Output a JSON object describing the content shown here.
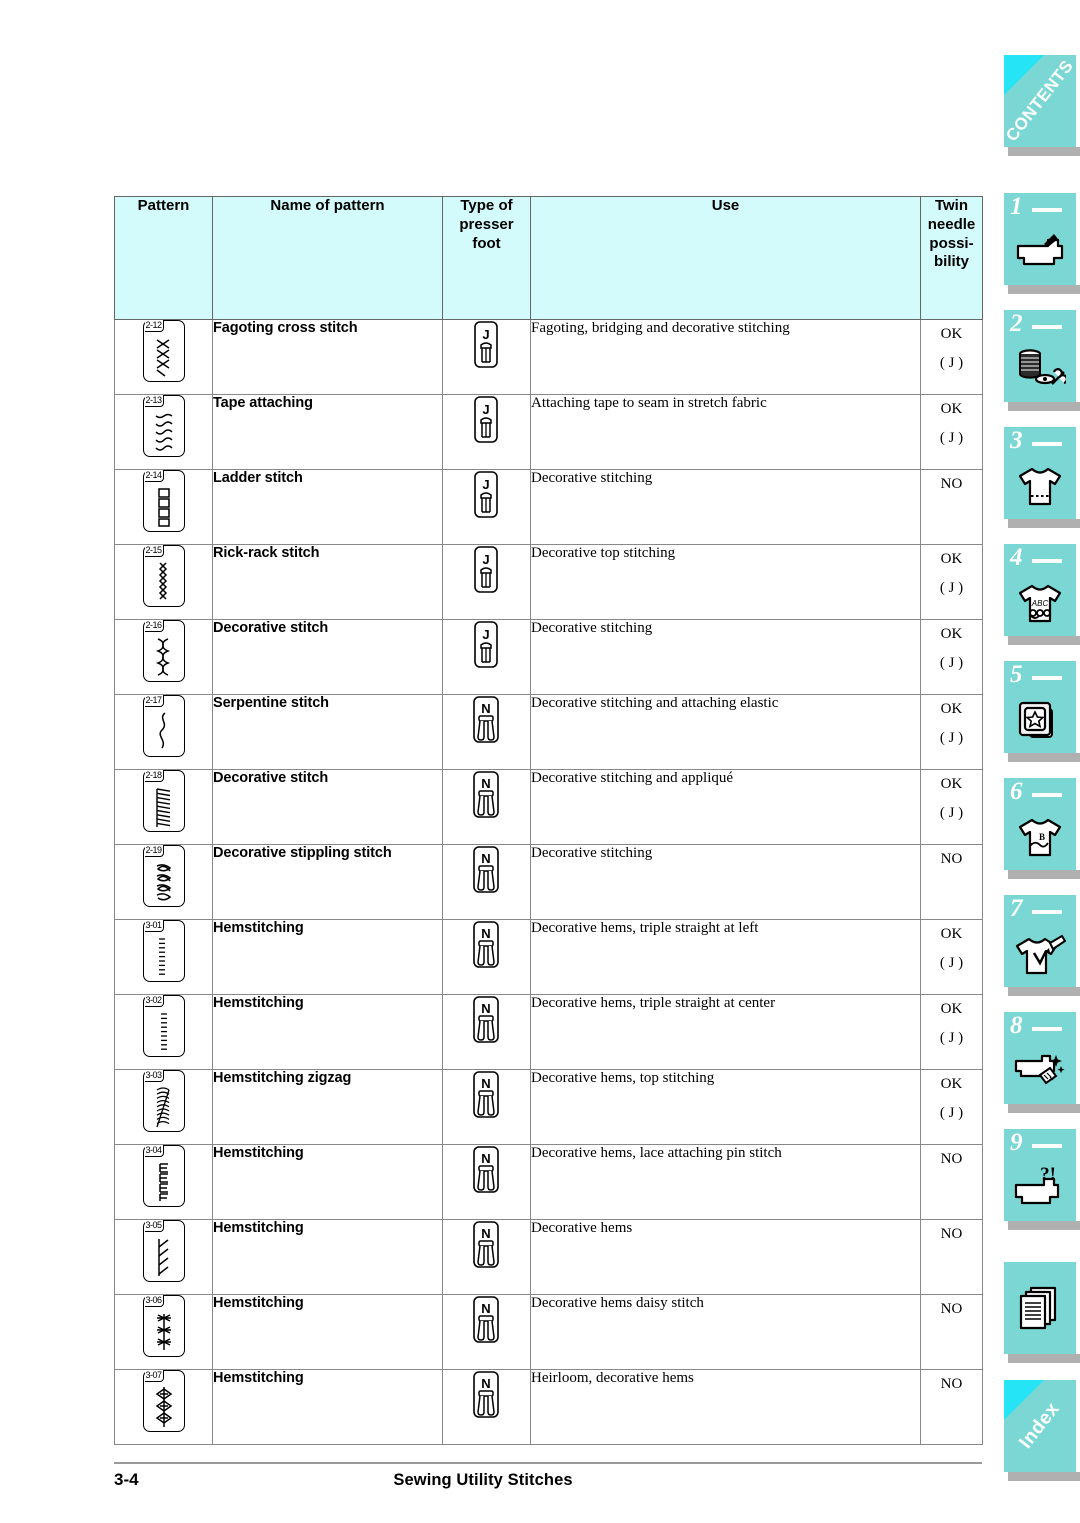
{
  "page": {
    "footer_page_number": "3-4",
    "footer_title": "Sewing Utility Stitches"
  },
  "colors": {
    "header_fill": "#d4fbfb",
    "tab_fill": "#7ad7d3",
    "tab_shadow": "#b0b0b0",
    "tab_corner": "#25e4f5",
    "border": "#888888"
  },
  "table": {
    "headers": {
      "pattern": "Pattern",
      "name": "Name of pattern",
      "presser_foot": "Type of presser foot",
      "use": "Use",
      "twin_needle": "Twin needle possi- bility"
    },
    "header_lines": {
      "presser_foot": [
        "Type of",
        "presser",
        "foot"
      ],
      "twin_needle": [
        "Twin",
        "needle",
        "possi-",
        "bility"
      ]
    },
    "rows": [
      {
        "code": "2-12",
        "name": "Fagoting cross stitch",
        "foot": "J",
        "use": "Fagoting, bridging and decorative stitching",
        "twin": "OK",
        "twin_sub": "( J )",
        "art": "cross"
      },
      {
        "code": "2-13",
        "name": "Tape attaching",
        "foot": "J",
        "use": "Attaching tape to seam in stretch fabric",
        "twin": "OK",
        "twin_sub": "( J )",
        "art": "wave-zig"
      },
      {
        "code": "2-14",
        "name": "Ladder stitch",
        "foot": "J",
        "use": "Decorative stitching",
        "twin": "NO",
        "twin_sub": "",
        "art": "ladder"
      },
      {
        "code": "2-15",
        "name": "Rick-rack stitch",
        "foot": "J",
        "use": "Decorative top stitching",
        "twin": "OK",
        "twin_sub": "( J )",
        "art": "rickrack"
      },
      {
        "code": "2-16",
        "name": "Decorative stitch",
        "foot": "J",
        "use": "Decorative stitching",
        "twin": "OK",
        "twin_sub": "( J )",
        "art": "braid"
      },
      {
        "code": "2-17",
        "name": "Serpentine stitch",
        "foot": "N",
        "use": "Decorative stitching and attaching elastic",
        "twin": "OK",
        "twin_sub": "( J )",
        "art": "serpentine"
      },
      {
        "code": "2-18",
        "name": "Decorative stitch",
        "foot": "N",
        "use": "Decorative stitching and appliqué",
        "twin": "OK",
        "twin_sub": "( J )",
        "art": "dense-zig"
      },
      {
        "code": "2-19",
        "name": "Decorative stippling stitch",
        "foot": "N",
        "use": "Decorative stitching",
        "twin": "NO",
        "twin_sub": "",
        "art": "stipple"
      },
      {
        "code": "3-01",
        "name": "Hemstitching",
        "foot": "N",
        "use": "Decorative hems, triple straight at left",
        "twin": "OK",
        "twin_sub": "( J )",
        "art": "triple-left"
      },
      {
        "code": "3-02",
        "name": "Hemstitching",
        "foot": "N",
        "use": "Decorative hems, triple straight at center",
        "twin": "OK",
        "twin_sub": "( J )",
        "art": "triple-center"
      },
      {
        "code": "3-03",
        "name": "Hemstitching zigzag",
        "foot": "N",
        "use": "Decorative hems, top stitching",
        "twin": "OK",
        "twin_sub": "( J )",
        "art": "hem-zigzag"
      },
      {
        "code": "3-04",
        "name": "Hemstitching",
        "foot": "N",
        "use": "Decorative hems, lace attaching pin stitch",
        "twin": "NO",
        "twin_sub": "",
        "art": "pin-stitch"
      },
      {
        "code": "3-05",
        "name": "Hemstitching",
        "foot": "N",
        "use": "Decorative hems",
        "twin": "NO",
        "twin_sub": "",
        "art": "slant"
      },
      {
        "code": "3-06",
        "name": "Hemstitching",
        "foot": "N",
        "use": "Decorative hems daisy stitch",
        "twin": "NO",
        "twin_sub": "",
        "art": "daisy"
      },
      {
        "code": "3-07",
        "name": "Hemstitching",
        "foot": "N",
        "use": "Heirloom, decorative hems",
        "twin": "NO",
        "twin_sub": "",
        "art": "diamond"
      }
    ]
  },
  "sidebar": {
    "tabs": [
      {
        "id": "contents",
        "label": "CONTENTS",
        "type": "corner",
        "icon": "contents-icon"
      },
      {
        "id": "ch1",
        "label": "1",
        "type": "numbered",
        "icon": "sewing-machine-icon"
      },
      {
        "id": "ch2",
        "label": "2",
        "type": "numbered",
        "icon": "thread-spool-icon"
      },
      {
        "id": "ch3",
        "label": "3",
        "type": "numbered",
        "icon": "shirt-stitched-icon"
      },
      {
        "id": "ch4",
        "label": "4",
        "type": "numbered",
        "icon": "shirt-abc-icon"
      },
      {
        "id": "ch5",
        "label": "5",
        "type": "numbered",
        "icon": "embroidery-hoop-star-icon"
      },
      {
        "id": "ch6",
        "label": "6",
        "type": "numbered",
        "icon": "shirt-monogram-icon"
      },
      {
        "id": "ch7",
        "label": "7",
        "type": "numbered",
        "icon": "shirt-edit-icon"
      },
      {
        "id": "ch8",
        "label": "8",
        "type": "numbered",
        "icon": "machine-cleaning-icon"
      },
      {
        "id": "ch9",
        "label": "9",
        "type": "numbered",
        "icon": "machine-troubleshoot-icon"
      },
      {
        "id": "appendix",
        "label": "",
        "type": "plain",
        "icon": "pages-stack-icon"
      },
      {
        "id": "index",
        "label": "Index",
        "type": "corner",
        "icon": "index-icon"
      }
    ],
    "tab_icon_labels": {
      "shirt_abc": "ABC",
      "shirt_monogram": "B",
      "machine_question": "?!"
    }
  }
}
